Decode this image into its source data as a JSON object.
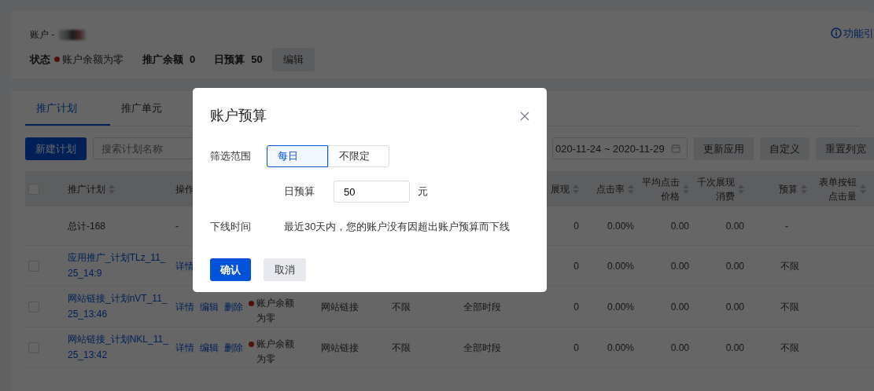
{
  "account": {
    "label": "账户 -"
  },
  "summary": [
    {
      "label": "状态",
      "value": "账户余额为零",
      "kind": "status"
    },
    {
      "label": "推广余额",
      "value": "0",
      "kind": "plain"
    },
    {
      "label": "日预算",
      "value": "50",
      "kind": "plain"
    }
  ],
  "edit_button": "编辑",
  "guide_link": "功能引",
  "tabs": [
    {
      "label": "推广计划",
      "selected": true
    },
    {
      "label": "推广单元",
      "selected": false
    }
  ],
  "toolbar": {
    "new_button": "新建计划",
    "search": {
      "placeholder": "搜索计划名称"
    },
    "date_range": "020-11-24 ~ 2020-11-29",
    "buttons": [
      "更新应用",
      "自定义",
      "重置列宽"
    ]
  },
  "table": {
    "select_all": {
      "checked": false
    },
    "columns": [
      {
        "label": "推广计划"
      },
      {
        "label": "操作"
      },
      {
        "label": "展现"
      },
      {
        "label": "点击率"
      },
      {
        "label": "平均点击价格"
      },
      {
        "label": "千次展现消费"
      },
      {
        "label": "预算"
      },
      {
        "label": "表单按钮点击量"
      }
    ],
    "rows": [
      {
        "kind": "total",
        "name": "总计-168",
        "ops": "-",
        "impressions": "0",
        "ctr": "0.00%",
        "avg_cpc": "0.00",
        "cpm": "0.00",
        "budget": "-"
      },
      {
        "kind": "plan",
        "checked": false,
        "name": "应用推广_计划TLz_11_25_14:9",
        "actions": [
          "详情"
        ],
        "impressions": "0",
        "ctr": "0.00%",
        "avg_cpc": "0.00",
        "cpm": "0.00",
        "budget": "不限"
      },
      {
        "kind": "plan",
        "checked": false,
        "name": "网站链接_计划nVT_11_25_13:46",
        "actions": [
          "详情",
          "编辑",
          "删除"
        ],
        "status": "账户余额为零",
        "type": "网站链接",
        "limit": "不限",
        "schedule": "全部时段",
        "impressions": "0",
        "ctr": "0.00%",
        "avg_cpc": "0.00",
        "cpm": "0.00",
        "budget": "不限"
      },
      {
        "kind": "plan",
        "checked": false,
        "name": "网站链接_计划NKL_11_25_13:42",
        "actions": [
          "详情",
          "编辑",
          "删除"
        ],
        "status": "账户余额为零",
        "type": "网站链接",
        "limit": "不限",
        "schedule": "全部时段",
        "impressions": "0",
        "ctr": "0.00%",
        "avg_cpc": "0.00",
        "cpm": "0.00",
        "budget": "不限"
      }
    ]
  },
  "dialog": {
    "title": "账户预算",
    "scope": {
      "label": "筛选范围",
      "options": [
        {
          "label": "每日",
          "selected": true
        },
        {
          "label": "不限定",
          "selected": false
        }
      ]
    },
    "daily_budget": {
      "label": "日预算",
      "value": "50",
      "unit": "元"
    },
    "offline": {
      "label": "下线时间",
      "text": "最近30天内，您的账户没有因超出账户预算而下线"
    },
    "buttons": [
      {
        "label": "确认",
        "kind": "primary"
      },
      {
        "label": "取消",
        "kind": "secondary"
      }
    ]
  }
}
